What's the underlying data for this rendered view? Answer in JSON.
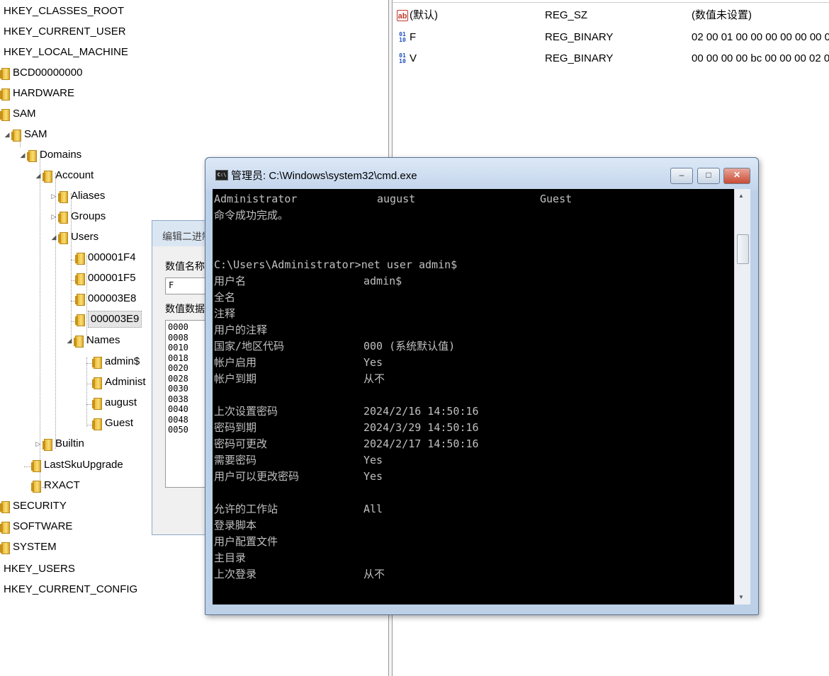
{
  "tree": {
    "roots_top": [
      "HKEY_CLASSES_ROOT",
      "HKEY_CURRENT_USER",
      "HKEY_LOCAL_MACHINE"
    ],
    "hklm_children": [
      "BCD00000000",
      "HARDWARE",
      "SAM"
    ],
    "sam": "SAM",
    "domains": "Domains",
    "account": "Account",
    "aliases": "Aliases",
    "groups": "Groups",
    "users": "Users",
    "user_keys": [
      "000001F4",
      "000001F5",
      "000003E8",
      "000003E9"
    ],
    "names": "Names",
    "name_keys": [
      "admin$",
      "Administ",
      "august",
      "Guest"
    ],
    "builtin": "Builtin",
    "last_sku": "LastSkuUpgrade",
    "rxact": "RXACT",
    "hklm_rest": [
      "SECURITY",
      "SOFTWARE",
      "SYSTEM"
    ],
    "roots_bottom": [
      "HKEY_USERS",
      "HKEY_CURRENT_CONFIG"
    ]
  },
  "values": [
    {
      "name": "(默认)",
      "type": "REG_SZ",
      "data": "(数值未设置)",
      "icon": "string-value-icon"
    },
    {
      "name": "F",
      "type": "REG_BINARY",
      "data": "02 00 01 00 00 00 00 00 00 0",
      "icon": "binary-value-icon"
    },
    {
      "name": "V",
      "type": "REG_BINARY",
      "data": "00 00 00 00 bc 00 00 00 02 0",
      "icon": "binary-value-icon"
    }
  ],
  "edit_dialog": {
    "title": "编辑二进制",
    "name_label": "数值名称",
    "name_value": "F",
    "data_label": "数值数据",
    "offsets": [
      "0000",
      "0008",
      "0010",
      "0018",
      "0020",
      "0028",
      "0030",
      "0038",
      "0040",
      "0048",
      "0050"
    ]
  },
  "cmd": {
    "title": "管理员: C:\\Windows\\system32\\cmd.exe",
    "buttons": {
      "min": "–",
      "max": "□",
      "close": "✕"
    },
    "accounts": [
      "Administrator",
      "august",
      "Guest"
    ],
    "success": "命令成功完成。",
    "prompt": "C:\\Users\\Administrator>net user admin$",
    "fields": [
      {
        "label": "用户名",
        "value": "admin$"
      },
      {
        "label": "全名",
        "value": ""
      },
      {
        "label": "注释",
        "value": ""
      },
      {
        "label": "用户的注释",
        "value": ""
      },
      {
        "label": "国家/地区代码",
        "value": "000 (系统默认值)"
      },
      {
        "label": "帐户启用",
        "value": "Yes"
      },
      {
        "label": "帐户到期",
        "value": "从不"
      },
      {
        "label": "",
        "value": ""
      },
      {
        "label": "上次设置密码",
        "value": "2024/2/16 14:50:16"
      },
      {
        "label": "密码到期",
        "value": "2024/3/29 14:50:16"
      },
      {
        "label": "密码可更改",
        "value": "2024/2/17 14:50:16"
      },
      {
        "label": "需要密码",
        "value": "Yes"
      },
      {
        "label": "用户可以更改密码",
        "value": "Yes"
      },
      {
        "label": "",
        "value": ""
      },
      {
        "label": "允许的工作站",
        "value": "All"
      },
      {
        "label": "登录脚本",
        "value": ""
      },
      {
        "label": "用户配置文件",
        "value": ""
      },
      {
        "label": "主目录",
        "value": ""
      },
      {
        "label": "上次登录",
        "value": "从不"
      }
    ]
  },
  "colors": {
    "console_bg": "#000000",
    "console_fg": "#c0c0c0",
    "folder": "#f2c94c"
  }
}
